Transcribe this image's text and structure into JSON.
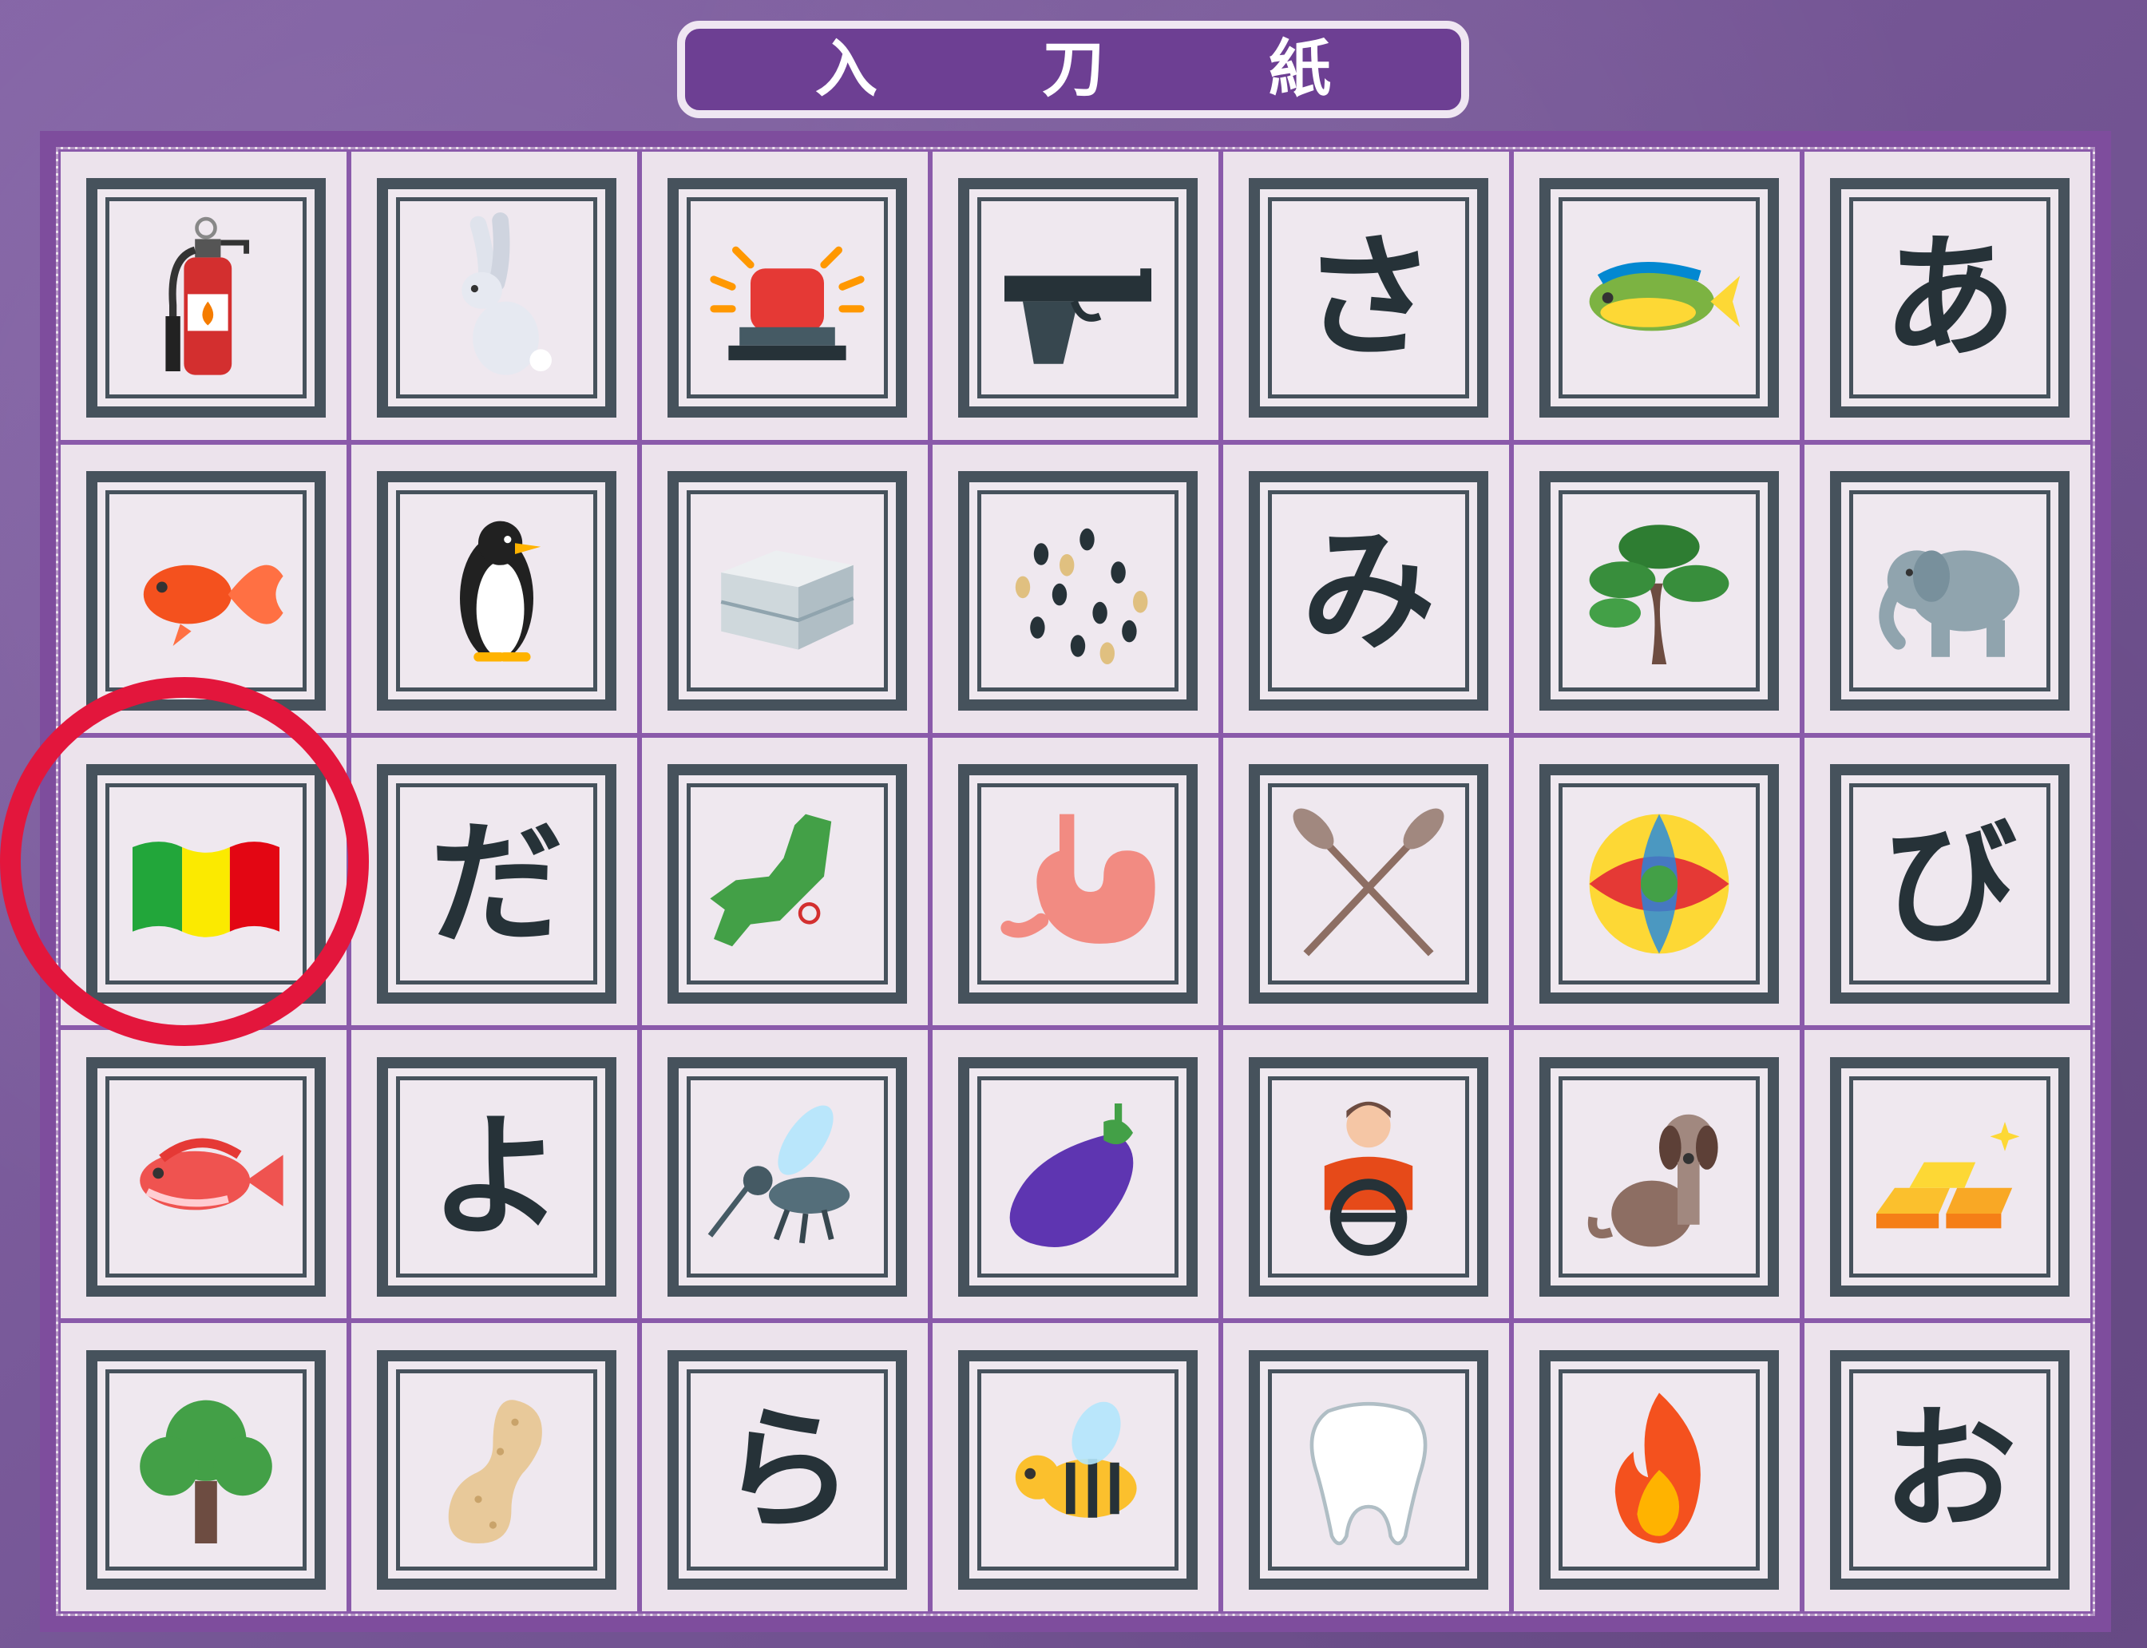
{
  "title": [
    "入",
    "刀",
    "紙"
  ],
  "colors": {
    "background": "#7a5a9a",
    "banner": "#6d3f93",
    "board_frame": "#7e4d9d",
    "tile_border": "#46525c",
    "highlight": "#e3163c"
  },
  "grid": {
    "rows": 5,
    "cols": 7,
    "highlighted_cell": {
      "row": 3,
      "col": 1
    }
  },
  "cells": [
    {
      "row": 1,
      "col": 1,
      "type": "icon",
      "icon": "fire-extinguisher"
    },
    {
      "row": 1,
      "col": 2,
      "type": "icon",
      "icon": "rabbit"
    },
    {
      "row": 1,
      "col": 3,
      "type": "icon",
      "icon": "siren-light"
    },
    {
      "row": 1,
      "col": 4,
      "type": "icon",
      "icon": "pistol"
    },
    {
      "row": 1,
      "col": 5,
      "type": "kana",
      "text": "さ"
    },
    {
      "row": 1,
      "col": 6,
      "type": "icon",
      "icon": "mahi-mahi-fish"
    },
    {
      "row": 1,
      "col": 7,
      "type": "kana",
      "text": "あ"
    },
    {
      "row": 2,
      "col": 1,
      "type": "icon",
      "icon": "goldfish"
    },
    {
      "row": 2,
      "col": 2,
      "type": "icon",
      "icon": "penguin"
    },
    {
      "row": 2,
      "col": 3,
      "type": "icon",
      "icon": "steamer-box"
    },
    {
      "row": 2,
      "col": 4,
      "type": "icon",
      "icon": "sesame-seeds"
    },
    {
      "row": 2,
      "col": 5,
      "type": "kana",
      "text": "み"
    },
    {
      "row": 2,
      "col": 6,
      "type": "icon",
      "icon": "pine-tree"
    },
    {
      "row": 2,
      "col": 7,
      "type": "icon",
      "icon": "elephant"
    },
    {
      "row": 3,
      "col": 1,
      "type": "icon",
      "icon": "mali-flag"
    },
    {
      "row": 3,
      "col": 2,
      "type": "kana",
      "text": "だ"
    },
    {
      "row": 3,
      "col": 3,
      "type": "icon",
      "icon": "japan-map"
    },
    {
      "row": 3,
      "col": 4,
      "type": "icon",
      "icon": "stomach"
    },
    {
      "row": 3,
      "col": 5,
      "type": "icon",
      "icon": "crossed-oars"
    },
    {
      "row": 3,
      "col": 6,
      "type": "icon",
      "icon": "temari-ball"
    },
    {
      "row": 3,
      "col": 7,
      "type": "kana",
      "text": "び"
    },
    {
      "row": 4,
      "col": 1,
      "type": "icon",
      "icon": "sea-bream"
    },
    {
      "row": 4,
      "col": 2,
      "type": "kana",
      "text": "よ"
    },
    {
      "row": 4,
      "col": 3,
      "type": "icon",
      "icon": "mosquito"
    },
    {
      "row": 4,
      "col": 4,
      "type": "icon",
      "icon": "eggplant"
    },
    {
      "row": 4,
      "col": 5,
      "type": "icon",
      "icon": "driver"
    },
    {
      "row": 4,
      "col": 6,
      "type": "icon",
      "icon": "dog"
    },
    {
      "row": 4,
      "col": 7,
      "type": "icon",
      "icon": "gold-bars"
    },
    {
      "row": 5,
      "col": 1,
      "type": "icon",
      "icon": "tree"
    },
    {
      "row": 5,
      "col": 2,
      "type": "icon",
      "icon": "peanut"
    },
    {
      "row": 5,
      "col": 3,
      "type": "kana",
      "text": "ら"
    },
    {
      "row": 5,
      "col": 4,
      "type": "icon",
      "icon": "bee"
    },
    {
      "row": 5,
      "col": 5,
      "type": "icon",
      "icon": "tooth"
    },
    {
      "row": 5,
      "col": 6,
      "type": "icon",
      "icon": "fire"
    },
    {
      "row": 5,
      "col": 7,
      "type": "kana",
      "text": "お"
    }
  ]
}
